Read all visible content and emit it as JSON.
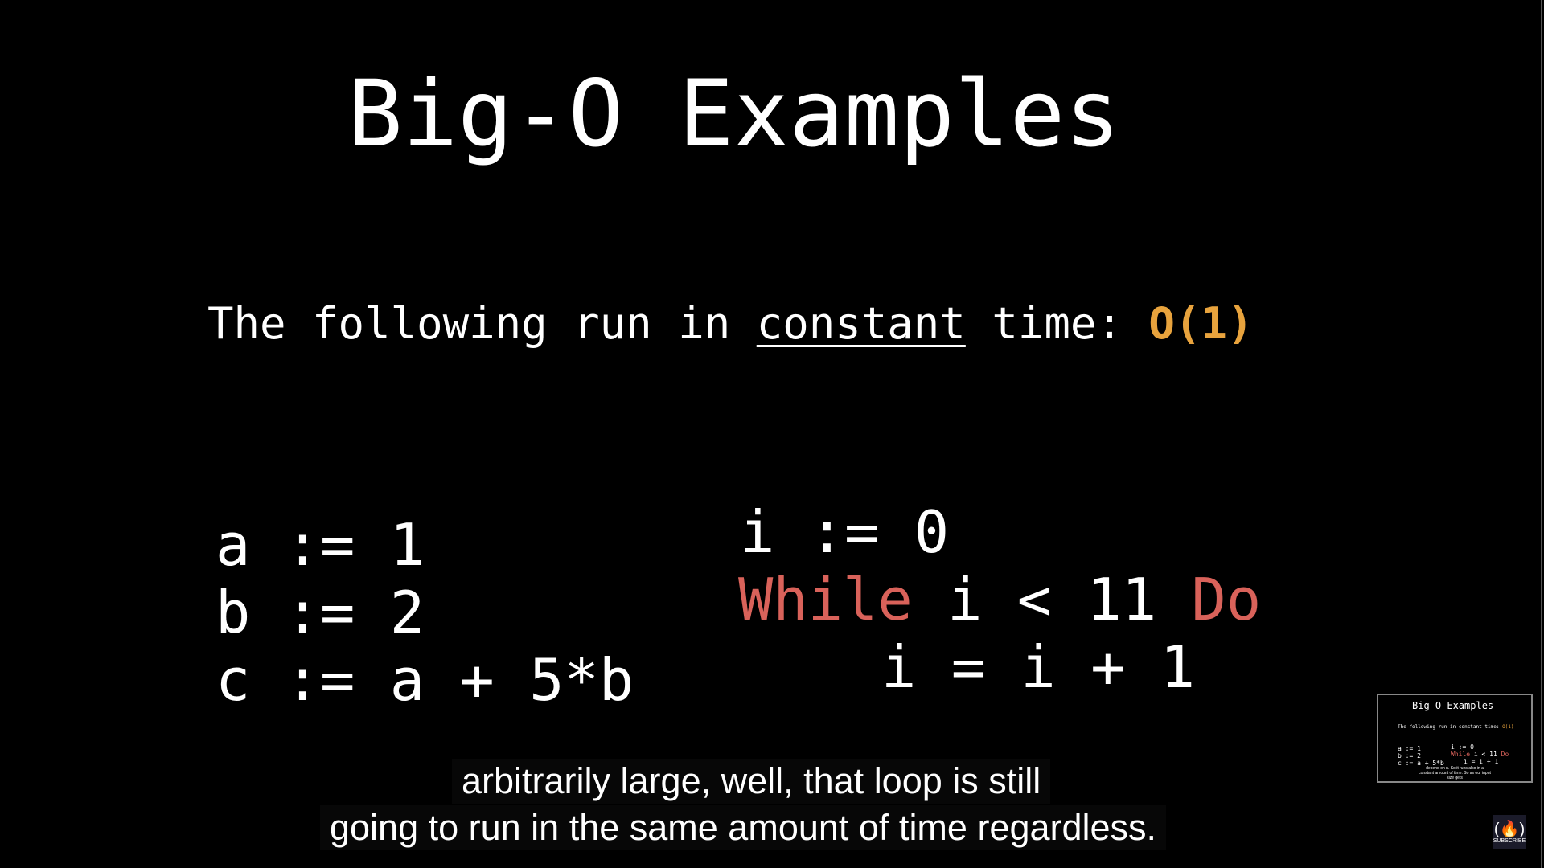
{
  "slide": {
    "title": "Big-O Examples",
    "subtitle": {
      "prefix": "The following run in ",
      "emphasis": "constant",
      "middle": " time: ",
      "complexity": "O(1)"
    },
    "left_code": [
      "a := 1",
      "b := 2",
      "c := a + 5*b"
    ],
    "right_code": {
      "line1": "i := 0",
      "while_kw": "While",
      "condition": " i < 11 ",
      "do_kw": "Do",
      "body": "i = i + 1"
    }
  },
  "captions": [
    "arbitrarily large, well, that loop is still",
    "going to run in the same amount of time regardless."
  ],
  "thumbnail": {
    "caption": "depend on n. So it runs also in a constant amount of time. So as our input size gets"
  },
  "subscribe": {
    "icon": "freecodecamp-flame-icon",
    "label": "SUBSCRIBE"
  },
  "colors": {
    "accent_orange": "#e8a33d",
    "keyword_red": "#d9625a",
    "background": "#000000"
  }
}
